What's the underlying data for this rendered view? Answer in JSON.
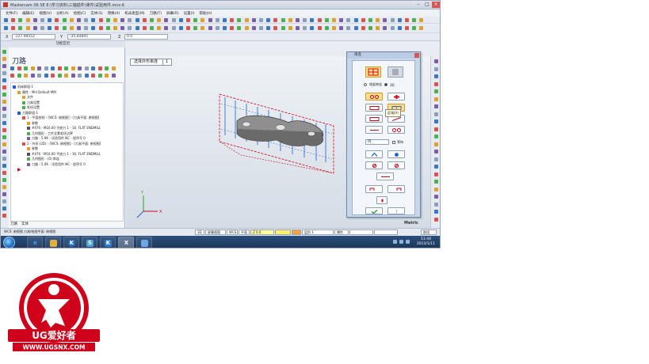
{
  "window": {
    "title": "Mastercam X6 SE E:\\学习资料\\三轴插件\\课件\\试验用件.mcx-6"
  },
  "menu": [
    "文件(F)",
    "编辑(E)",
    "视图(V)",
    "分析(A)",
    "绘图(C)",
    "实体(S)",
    "转换(X)",
    "机床类型(M)",
    "刀路(T)",
    "屏幕(R)",
    "设置(I)",
    "帮助(H)"
  ],
  "coords": {
    "x_label": "X",
    "x_value": "-127.98552",
    "y_label": "Y",
    "y_value": "-35.84895",
    "z_label": "Z",
    "z_value": "0.0"
  },
  "left_panel": {
    "header": "功能区栏",
    "title": "刀路",
    "tree": [
      {
        "indent": 0,
        "text": "机床群组-1"
      },
      {
        "indent": 1,
        "text": "属性 - Mill Default MM"
      },
      {
        "indent": 2,
        "text": "文件"
      },
      {
        "indent": 2,
        "text": "刀具设置"
      },
      {
        "indent": 2,
        "text": "毛坯设置"
      },
      {
        "indent": 1,
        "text": "刀路群组-1"
      },
      {
        "indent": 2,
        "text": "1 - 平面铣削 - [WCS: 俯视图] - [刀具平面: 俯视图]"
      },
      {
        "indent": 3,
        "text": "参数"
      },
      {
        "indent": 3,
        "text": "#476 - M16.00 平底刀 1 - 16. FLAT ENDMILL"
      },
      {
        "indent": 3,
        "text": "几何图形 - 工件全素毛坯边界"
      },
      {
        "indent": 3,
        "text": "刀路 - 5.9K - 试验用件.NC - 程序号 0"
      },
      {
        "indent": 2,
        "text": "2 - 外形 (2D) - [WCS: 俯视图] - [刀具平面: 俯视图]"
      },
      {
        "indent": 3,
        "text": "参数"
      },
      {
        "indent": 3,
        "text": "#476 - M16.00 平底刀 1 - 16. FLAT ENDMILL"
      },
      {
        "indent": 3,
        "text": "几何图形 - (0) 串连"
      },
      {
        "indent": 3,
        "text": "刀路 - 5.0K - 试验用件.NC - 程序号 0"
      }
    ],
    "tabs": [
      "刀路",
      "实体"
    ]
  },
  "viewport": {
    "tab_label": "选择外形串连",
    "tab_number": "1",
    "axis_x": "X",
    "axis_y": "Y"
  },
  "dialog": {
    "title": "串连",
    "radio_3d": "3D",
    "radio_2d": "线架串连",
    "inner_option": "内",
    "equal_label": "等待",
    "tooltip": "区域(A)"
  },
  "status": {
    "metric": "Metric",
    "fields": [
      "3D",
      "屏幕视图",
      "WCS",
      "平面",
      "Z 0.0",
      "",
      "",
      "层别 1",
      "属性",
      "",
      "",
      "群组"
    ],
    "left_label": "WCS: 俯视图 刀具/绘图平面: 俯视图"
  },
  "clock": {
    "time": "11:44",
    "date": "2013/1/11"
  },
  "logo": {
    "brand": "UG爱好者",
    "url": "WWW.UGSNX.COM"
  },
  "colors": {
    "accent": "#d0021b",
    "taskbar": "#1b3456",
    "highlight": "#ffe089"
  }
}
